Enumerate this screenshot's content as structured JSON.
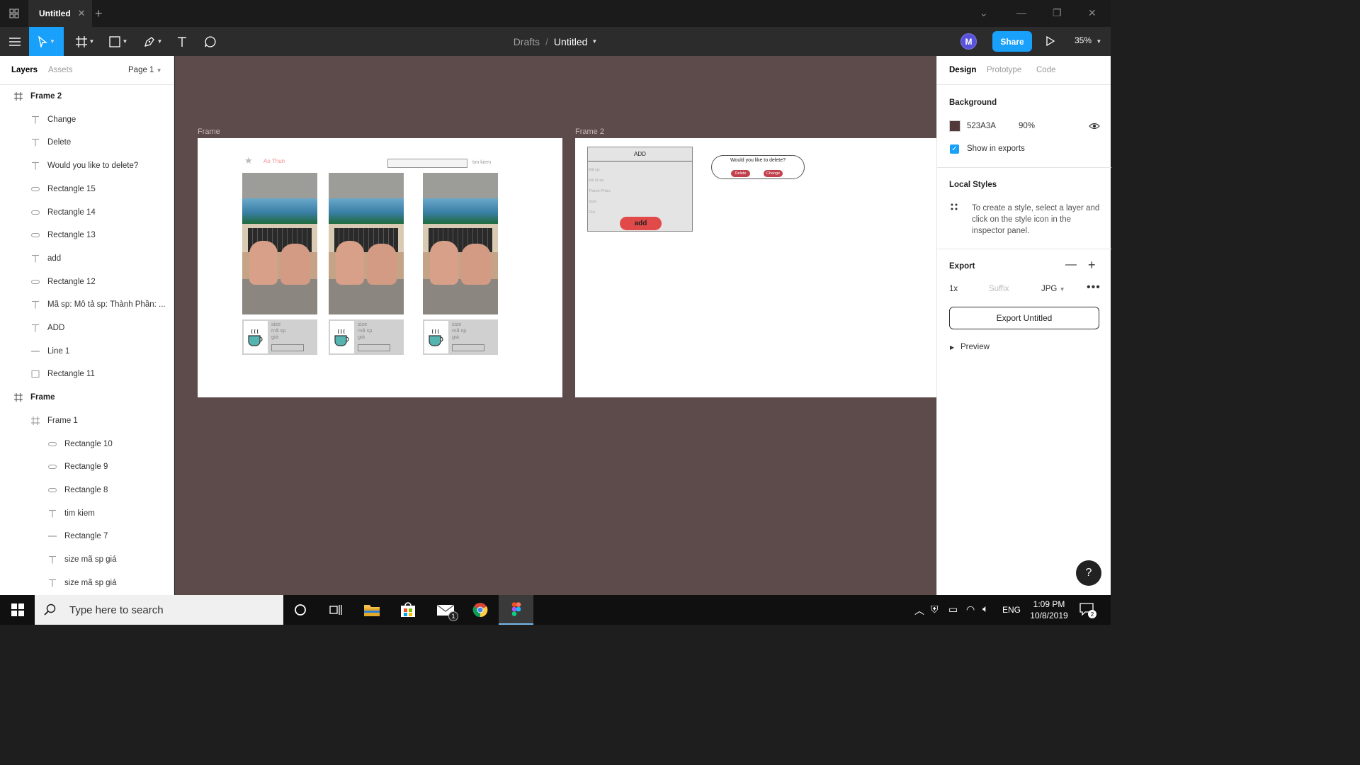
{
  "window": {
    "tab_title": "Untitled"
  },
  "toolbar": {
    "breadcrumb_root": "Drafts",
    "breadcrumb_separator": "/",
    "file_name": "Untitled",
    "avatar_initial": "M",
    "share_label": "Share",
    "zoom_label": "35%"
  },
  "left_panel": {
    "tab_layers": "Layers",
    "tab_assets": "Assets",
    "page_label": "Page 1",
    "layers": [
      {
        "label": "Frame 2",
        "icon": "frame-icon",
        "indent": 0
      },
      {
        "label": "Change",
        "icon": "text-icon",
        "indent": 1
      },
      {
        "label": "Delete",
        "icon": "text-icon",
        "indent": 1
      },
      {
        "label": "Would you like to delete?",
        "icon": "text-icon",
        "indent": 1
      },
      {
        "label": "Rectangle 15",
        "icon": "ellipse-icon",
        "indent": 1
      },
      {
        "label": "Rectangle 14",
        "icon": "ellipse-icon",
        "indent": 1
      },
      {
        "label": "Rectangle 13",
        "icon": "ellipse-icon",
        "indent": 1
      },
      {
        "label": "add",
        "icon": "text-icon",
        "indent": 1
      },
      {
        "label": "Rectangle 12",
        "icon": "ellipse-icon",
        "indent": 1
      },
      {
        "label": "Mã sp: Mô tả sp: Thành Phần: ...",
        "icon": "text-icon",
        "indent": 1
      },
      {
        "label": "ADD",
        "icon": "text-icon",
        "indent": 1
      },
      {
        "label": "Line 1",
        "icon": "line-icon",
        "indent": 1
      },
      {
        "label": "Rectangle 11",
        "icon": "rectangle-icon",
        "indent": 1
      },
      {
        "label": "Frame",
        "icon": "frame-icon",
        "indent": 0
      },
      {
        "label": "Frame 1",
        "icon": "frame-icon",
        "indent": 1
      },
      {
        "label": "Rectangle 10",
        "icon": "ellipse-icon",
        "indent": 2
      },
      {
        "label": "Rectangle 9",
        "icon": "ellipse-icon",
        "indent": 2
      },
      {
        "label": "Rectangle 8",
        "icon": "ellipse-icon",
        "indent": 2
      },
      {
        "label": "tim kiem",
        "icon": "text-icon",
        "indent": 2
      },
      {
        "label": "Rectangle 7",
        "icon": "line-icon",
        "indent": 2
      },
      {
        "label": "size mã sp giá",
        "icon": "text-icon",
        "indent": 2
      },
      {
        "label": "size mã sp giá",
        "icon": "text-icon",
        "indent": 2
      }
    ]
  },
  "canvas": {
    "frame_label": "Frame",
    "frame2_label": "Frame 2",
    "header_text": "Ao Thun",
    "search_text": "tim kiem",
    "card_lines": [
      "size",
      "mã sp",
      "giá"
    ],
    "add_form": {
      "title": "ADD",
      "fields": [
        "Mã sp:",
        "Mô tả sp:",
        "Thành Phần:",
        "Size:",
        "Giá:"
      ],
      "button": "add"
    },
    "dialog": {
      "question": "Would you like to delete?",
      "delete_label": "Delete",
      "change_label": "Change"
    }
  },
  "right_panel": {
    "tab_design": "Design",
    "tab_prototype": "Prototype",
    "tab_code": "Code",
    "background_title": "Background",
    "background_hex": "523A3A",
    "background_opacity": "90%",
    "background_color": "#523a3a",
    "show_in_exports": "Show in exports",
    "local_styles_title": "Local Styles",
    "local_styles_hint": "To create a style, select a layer and click on the style icon in the inspector panel.",
    "export_title": "Export",
    "export_scale": "1x",
    "export_suffix_placeholder": "Suffix",
    "export_format": "JPG",
    "export_button": "Export Untitled",
    "preview_label": "Preview"
  },
  "help_label": "?",
  "taskbar": {
    "search_placeholder": "Type here to search",
    "mail_badge": "1",
    "language": "ENG",
    "time": "1:09 PM",
    "date": "10/8/2019",
    "notification_count": "2"
  }
}
